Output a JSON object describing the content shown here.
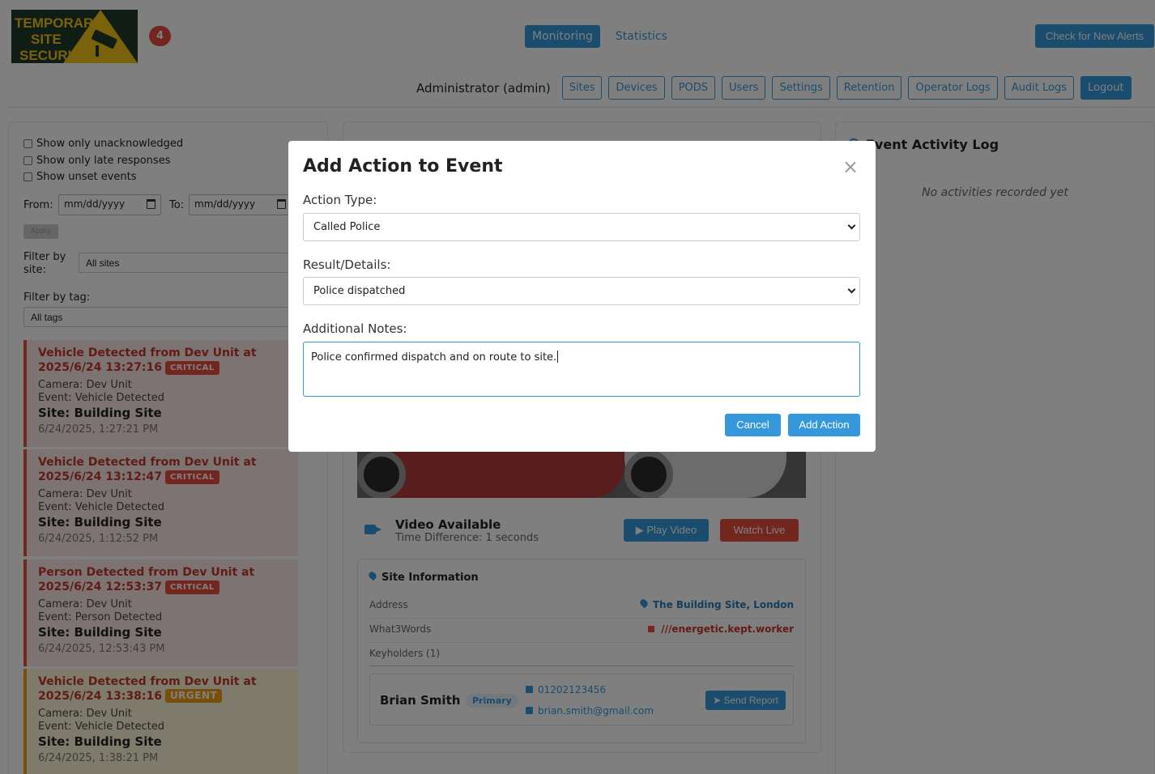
{
  "header": {
    "logo_text": [
      "TEMPORARY",
      "SITE",
      "SECURITY"
    ],
    "alert_count": "4",
    "nav_tabs": [
      {
        "label": "Monitoring",
        "active": true
      },
      {
        "label": "Statistics",
        "active": false
      }
    ],
    "check_alerts_label": "Check for New Alerts",
    "admin_label": "Administrator (admin)",
    "admin_buttons": [
      "Sites",
      "Devices",
      "PODS",
      "Users",
      "Settings",
      "Retention",
      "Operator Logs",
      "Audit Logs"
    ],
    "logout_label": "Logout"
  },
  "filters": {
    "checkboxes": [
      "Show only unacknowledged",
      "Show only late responses",
      "Show unset events"
    ],
    "from_label": "From:",
    "to_label": "To:",
    "date_placeholder": "mm/dd/yyyy",
    "apply_label": "Apply",
    "site_label": "Filter by site:",
    "site_value": "All sites",
    "tag_label": "Filter by tag:",
    "tag_value": "All tags"
  },
  "events": [
    {
      "title": "Vehicle Detected from Dev Unit at 2025/6/24 13:27:16",
      "priority": "CRITICAL",
      "camera": "Camera: Dev Unit",
      "event": "Event: Vehicle Detected",
      "site": "Site: Building Site",
      "time": "6/24/2025, 1:27:21 PM"
    },
    {
      "title": "Vehicle Detected from Dev Unit at 2025/6/24 13:12:47",
      "priority": "CRITICAL",
      "camera": "Camera: Dev Unit",
      "event": "Event: Vehicle Detected",
      "site": "Site: Building Site",
      "time": "6/24/2025, 1:12:52 PM"
    },
    {
      "title": "Person Detected from Dev Unit at 2025/6/24 12:53:37",
      "priority": "CRITICAL",
      "camera": "Camera: Dev Unit",
      "event": "Event: Person Detected",
      "site": "Site: Building Site",
      "time": "6/24/2025, 12:53:43 PM"
    },
    {
      "title": "Vehicle Detected from Dev Unit at 2025/6/24 13:38:16",
      "priority": "URGENT",
      "camera": "Camera: Dev Unit",
      "event": "Event: Vehicle Detected",
      "site": "Site: Building Site",
      "time": "6/24/2025, 1:38:21 PM"
    }
  ],
  "video": {
    "title": "Video Available",
    "time_diff": "Time Difference: 1 seconds",
    "play_label": "Play Video",
    "live_label": "Watch Live"
  },
  "site_info": {
    "title": "Site Information",
    "address_label": "Address",
    "address_value": "The Building Site, London",
    "w3w_label": "What3Words",
    "w3w_value": "///energetic.kept.worker",
    "keyholders_label": "Keyholders (1)",
    "keyholder": {
      "name": "Brian Smith",
      "badge": "Primary",
      "phone": "01202123456",
      "email": "brian.smith@gmail.com",
      "send_label": "Send Report"
    }
  },
  "activity_log": {
    "title": "Event Activity Log",
    "empty": "No activities recorded yet"
  },
  "modal": {
    "title": "Add Action to Event",
    "close": "×",
    "action_type_label": "Action Type:",
    "action_type_value": "Called Police",
    "result_label": "Result/Details:",
    "result_value": "Police dispatched",
    "notes_label": "Additional Notes:",
    "notes_value": "Police confirmed dispatch and on route to site.",
    "cancel_label": "Cancel",
    "add_label": "Add Action"
  },
  "colors": {
    "primary": "#3498db",
    "danger": "#e74c3c",
    "warning": "#f39c12",
    "logo_yellow": "#f0c419",
    "logo_green": "#1f3a2a"
  },
  "icons": [
    "camera-logo-icon",
    "video-camera-icon",
    "play-icon",
    "map-pin-icon",
    "w3w-icon",
    "phone-icon",
    "envelope-icon",
    "send-icon",
    "calendar-icon",
    "close-icon",
    "chevron-down-icon",
    "clock-icon"
  ]
}
